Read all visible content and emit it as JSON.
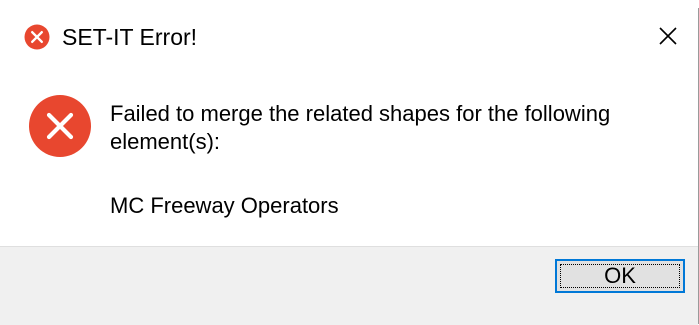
{
  "dialog": {
    "title": "SET-IT Error!",
    "message_line1": "Failed to merge the related shapes for the following",
    "message_line2": "element(s):",
    "element_name": "MC Freeway Operators",
    "ok_label": "OK"
  },
  "icons": {
    "title": "error-icon",
    "message": "error-icon",
    "close": "close-icon"
  },
  "colors": {
    "error_red": "#e8472f",
    "button_border": "#0078d7",
    "button_bg": "#e1e1e1",
    "footer_bg": "#f0f0f0"
  }
}
